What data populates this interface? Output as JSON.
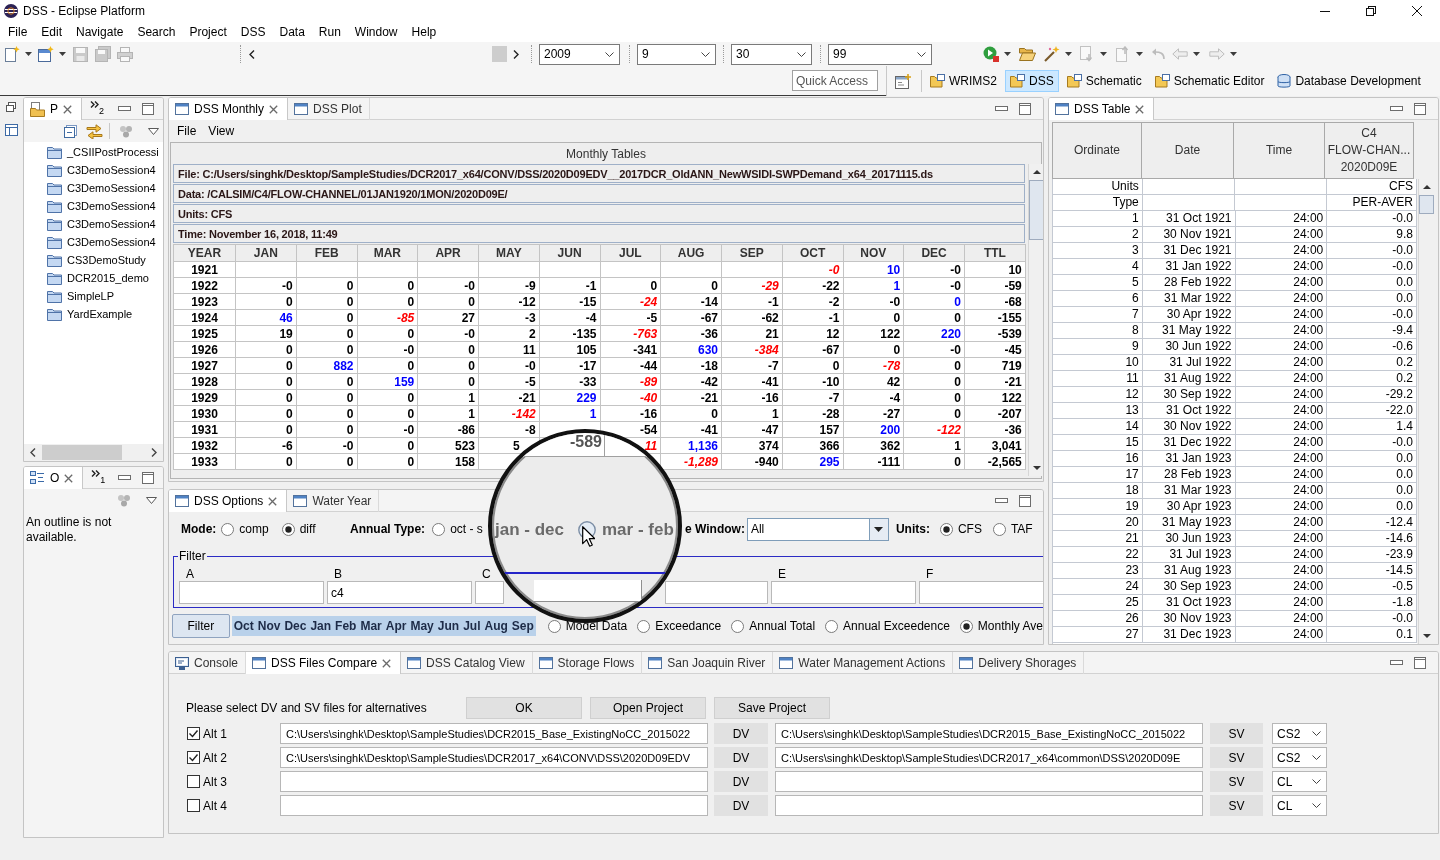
{
  "window": {
    "title": "DSS - Eclipse Platform"
  },
  "menu": [
    "File",
    "Edit",
    "Navigate",
    "Search",
    "Project",
    "DSS",
    "Data",
    "Run",
    "Window",
    "Help"
  ],
  "toolbar": {
    "left_tools": [
      {
        "kind": "new",
        "dropdown": true,
        "disabled": false
      },
      {
        "kind": "new-window",
        "dropdown": true,
        "disabled": false
      },
      {
        "kind": "save",
        "dropdown": false,
        "disabled": true
      },
      {
        "kind": "save-all",
        "dropdown": false,
        "disabled": true
      },
      {
        "kind": "print",
        "dropdown": false,
        "disabled": true
      }
    ],
    "combos": [
      {
        "value": "2009"
      },
      {
        "value": "9"
      },
      {
        "value": "30"
      },
      {
        "value": "99"
      }
    ],
    "right_tools": [
      {
        "kind": "run",
        "dropdown": true,
        "disabled": false
      },
      {
        "kind": "open",
        "dropdown": false,
        "disabled": false
      },
      {
        "kind": "wand",
        "dropdown": true,
        "disabled": false
      },
      {
        "kind": "next",
        "dropdown": true,
        "disabled": true
      },
      {
        "kind": "previous",
        "dropdown": true,
        "disabled": true
      },
      {
        "kind": "last-edit",
        "dropdown": false,
        "disabled": true
      },
      {
        "kind": "back",
        "dropdown": true,
        "disabled": true
      },
      {
        "kind": "forward",
        "dropdown": true,
        "disabled": true
      }
    ],
    "quick_access": {
      "placeholder": "Quick Access"
    },
    "perspectives": [
      {
        "label": "WRIMS2",
        "kind": "folder",
        "selected": false
      },
      {
        "label": "DSS",
        "kind": "folder",
        "selected": true
      },
      {
        "label": "Schematic",
        "kind": "folder",
        "selected": false
      },
      {
        "label": "Schematic Editor",
        "kind": "folder",
        "selected": false
      },
      {
        "label": "Database Development",
        "kind": "database",
        "selected": false
      }
    ]
  },
  "project_explorer": {
    "tab": {
      "label": "P",
      "selected": true
    },
    "overflow_count": "2",
    "items": [
      "_CSIIPostProcessi",
      "C3DemoSession4",
      "C3DemoSession4",
      "C3DemoSession4",
      "C3DemoSession4",
      "C3DemoSession4",
      "CS3DemoStudy",
      "DCR2015_demo",
      "SimpleLP",
      "YardExample"
    ]
  },
  "outline": {
    "tab": {
      "label": "O",
      "selected": true
    },
    "overflow_count": "1",
    "message": "An outline is not available."
  },
  "monthly_view": {
    "tabs": [
      {
        "label": "DSS Monthly",
        "selected": true
      },
      {
        "label": "DSS Plot",
        "selected": false
      }
    ],
    "menu": [
      "File",
      "View"
    ],
    "panel_title": "Monthly Tables",
    "info": [
      "File: C:/Users/singhk/Desktop/SampleStudies/DCR2017_x64/CONV/DSS/2020D09EDV__2017DCR_OldANN_NewWSIDI-SWPDemand_x64_20171115.ds",
      "Data: /CALSIM/C4/FLOW-CHANNEL/01JAN1920/1MON/2020D09E/",
      "Units: CFS",
      "Time: November 16, 2018, 11:49"
    ],
    "table": {
      "columns": [
        "YEAR",
        "JAN",
        "FEB",
        "MAR",
        "APR",
        "MAY",
        "JUN",
        "JUL",
        "AUG",
        "SEP",
        "OCT",
        "NOV",
        "DEC",
        "TTL"
      ],
      "rows": [
        [
          "1921",
          "",
          "",
          "",
          "",
          "",
          "",
          "",
          "",
          "",
          {
            "text": "-0",
            "color": "#ff0000"
          },
          {
            "text": "10",
            "color": "#0000ff"
          },
          "-0",
          "10"
        ],
        [
          "1922",
          "-0",
          "0",
          "0",
          "-0",
          "-9",
          "-1",
          "0",
          "0",
          {
            "text": "-29",
            "color": "#ff0000"
          },
          "-22",
          {
            "text": "1",
            "color": "#0000ff"
          },
          "-0",
          "-59"
        ],
        [
          "1923",
          "0",
          "0",
          "0",
          "0",
          "-12",
          "-15",
          {
            "text": "-24",
            "color": "#ff0000"
          },
          "-14",
          "-1",
          "-2",
          "-0",
          {
            "text": "0",
            "color": "#0000ff"
          },
          "-68"
        ],
        [
          "1924",
          {
            "text": "46",
            "color": "#0000ff"
          },
          "0",
          {
            "text": "-85",
            "color": "#ff0000"
          },
          "27",
          "-3",
          "-4",
          "-5",
          "-67",
          "-62",
          "-1",
          "0",
          "0",
          "-155"
        ],
        [
          "1925",
          "19",
          "0",
          "0",
          "-0",
          "2",
          "-135",
          {
            "text": "-763",
            "color": "#ff0000"
          },
          "-36",
          "21",
          "12",
          "122",
          {
            "text": "220",
            "color": "#0000ff"
          },
          "-539"
        ],
        [
          "1926",
          "0",
          "0",
          "-0",
          "0",
          "11",
          "105",
          "-341",
          {
            "text": "630",
            "color": "#0000ff"
          },
          {
            "text": "-384",
            "color": "#ff0000"
          },
          "-67",
          "0",
          "-0",
          "-45"
        ],
        [
          "1927",
          "0",
          {
            "text": "882",
            "color": "#0000ff"
          },
          "0",
          "0",
          "-0",
          "-17",
          "-44",
          "-18",
          "-7",
          "0",
          {
            "text": "-78",
            "color": "#ff0000"
          },
          "0",
          "719"
        ],
        [
          "1928",
          "0",
          "0",
          {
            "text": "159",
            "color": "#0000ff"
          },
          "0",
          "-5",
          "-33",
          {
            "text": "-89",
            "color": "#ff0000"
          },
          "-42",
          "-41",
          "-10",
          "42",
          "0",
          "-21"
        ],
        [
          "1929",
          "0",
          "0",
          "0",
          "1",
          "-21",
          {
            "text": "229",
            "color": "#0000ff"
          },
          {
            "text": "-40",
            "color": "#ff0000"
          },
          "-21",
          "-16",
          "-7",
          "-4",
          "0",
          "122"
        ],
        [
          "1930",
          "0",
          "0",
          "0",
          "1",
          {
            "text": "-142",
            "color": "#ff0000"
          },
          {
            "text": "1",
            "color": "#0000ff"
          },
          "-16",
          "0",
          "1",
          "-28",
          "-27",
          "0",
          "-207"
        ],
        [
          "1931",
          "0",
          "0",
          "-0",
          "-86",
          "-8",
          "",
          "-54",
          "-41",
          "-47",
          "157",
          {
            "text": "200",
            "color": "#0000ff"
          },
          {
            "text": "-122",
            "color": "#ff0000"
          },
          "-36"
        ],
        [
          "1932",
          "-6",
          "-0",
          "0",
          "523",
          "5",
          "",
          {
            "text": "11",
            "color": "#ff0000"
          },
          {
            "text": "1,136",
            "color": "#0000ff"
          },
          "374",
          "366",
          "362",
          "1",
          "3,041"
        ],
        [
          "1933",
          "0",
          "0",
          "0",
          "158",
          "",
          "",
          "",
          {
            "text": "-1,289",
            "color": "#ff0000"
          },
          "-940",
          {
            "text": "295",
            "color": "#0000ff"
          },
          "-111",
          "0",
          "-2,565"
        ]
      ]
    }
  },
  "options_view": {
    "tabs": [
      {
        "label": "DSS Options",
        "selected": true
      },
      {
        "label": "Water Year",
        "selected": false
      }
    ],
    "mode": {
      "label": "Mode:",
      "options": [
        {
          "label": "comp",
          "selected": false
        },
        {
          "label": "diff",
          "selected": true
        }
      ]
    },
    "annual_type": {
      "label": "Annual Type:",
      "options": [
        {
          "label": "oct - s",
          "selected": false
        }
      ]
    },
    "time_window": {
      "label": "e Window:",
      "value": "All"
    },
    "units": {
      "label": "Units:",
      "options": [
        {
          "label": "CFS",
          "selected": true
        },
        {
          "label": "TAF",
          "selected": false
        }
      ]
    },
    "filter": {
      "title": "Filter",
      "groups": [
        {
          "kind": "labeled",
          "label": "A"
        },
        {
          "kind": "labeled",
          "label": "B",
          "value": "c4"
        },
        {
          "kind": "labeled",
          "label": "C"
        },
        {
          "kind": "bare"
        },
        {
          "kind": "labeled",
          "label": "E"
        },
        {
          "kind": "labeled",
          "label": "F"
        }
      ]
    },
    "filter_button": "Filter",
    "months": [
      {
        "label": "Oct",
        "selected": true
      },
      {
        "label": "Nov",
        "selected": true
      },
      {
        "label": "Dec",
        "selected": true
      },
      {
        "label": "Jan",
        "selected": true
      },
      {
        "label": "Feb",
        "selected": true
      },
      {
        "label": "Mar",
        "selected": true
      },
      {
        "label": "Apr",
        "selected": true
      },
      {
        "label": "May",
        "selected": true
      },
      {
        "label": "Jun",
        "selected": true
      },
      {
        "label": "Jul",
        "selected": true
      },
      {
        "label": "Aug",
        "selected": true
      },
      {
        "label": "Sep",
        "selected": true
      }
    ],
    "views": [
      {
        "label": "Model Data",
        "selected": false
      },
      {
        "label": "Exceedance",
        "selected": false
      },
      {
        "label": "Annual Total",
        "selected": false
      },
      {
        "label": "Annual Exceedence",
        "selected": false
      },
      {
        "label": "Monthly Ave",
        "selected": true
      }
    ]
  },
  "magnifier": {
    "cell": "-589",
    "items": [
      {
        "kind": "text",
        "label": "jan - dec"
      },
      {
        "kind": "radio",
        "label": "mar - feb",
        "selected": false
      }
    ]
  },
  "table_view": {
    "tab": {
      "label": "DSS Table",
      "selected": true
    },
    "columns": [
      {
        "lines": [
          "Ordinate"
        ]
      },
      {
        "lines": [
          "Date"
        ]
      },
      {
        "lines": [
          "Time"
        ]
      },
      {
        "lines": [
          "C4",
          "FLOW-CHAN...",
          "2020D09E"
        ]
      }
    ],
    "meta_rows": [
      {
        "label": "Units",
        "value": "CFS"
      },
      {
        "label": "Type",
        "value": "PER-AVER"
      }
    ],
    "rows": [
      [
        "1",
        "31 Oct 1921",
        "24:00",
        "-0.0"
      ],
      [
        "2",
        "30 Nov 1921",
        "24:00",
        "9.8"
      ],
      [
        "3",
        "31 Dec 1921",
        "24:00",
        "-0.0"
      ],
      [
        "4",
        "31 Jan 1922",
        "24:00",
        "-0.0"
      ],
      [
        "5",
        "28 Feb 1922",
        "24:00",
        "0.0"
      ],
      [
        "6",
        "31 Mar 1922",
        "24:00",
        "0.0"
      ],
      [
        "7",
        "30 Apr 1922",
        "24:00",
        "-0.0"
      ],
      [
        "8",
        "31 May 1922",
        "24:00",
        "-9.4"
      ],
      [
        "9",
        "30 Jun 1922",
        "24:00",
        "-0.6"
      ],
      [
        "10",
        "31 Jul 1922",
        "24:00",
        "0.2"
      ],
      [
        "11",
        "31 Aug 1922",
        "24:00",
        "0.2"
      ],
      [
        "12",
        "30 Sep 1922",
        "24:00",
        "-29.2"
      ],
      [
        "13",
        "31 Oct 1922",
        "24:00",
        "-22.0"
      ],
      [
        "14",
        "30 Nov 1922",
        "24:00",
        "1.4"
      ],
      [
        "15",
        "31 Dec 1922",
        "24:00",
        "-0.0"
      ],
      [
        "16",
        "31 Jan 1923",
        "24:00",
        "0.0"
      ],
      [
        "17",
        "28 Feb 1923",
        "24:00",
        "0.0"
      ],
      [
        "18",
        "31 Mar 1923",
        "24:00",
        "0.0"
      ],
      [
        "19",
        "30 Apr 1923",
        "24:00",
        "0.0"
      ],
      [
        "20",
        "31 May 1923",
        "24:00",
        "-12.4"
      ],
      [
        "21",
        "30 Jun 1923",
        "24:00",
        "-14.6"
      ],
      [
        "22",
        "31 Jul 1923",
        "24:00",
        "-23.9"
      ],
      [
        "23",
        "31 Aug 1923",
        "24:00",
        "-14.5"
      ],
      [
        "24",
        "30 Sep 1923",
        "24:00",
        "-0.5"
      ],
      [
        "25",
        "31 Oct 1923",
        "24:00",
        "-1.8"
      ],
      [
        "26",
        "30 Nov 1923",
        "24:00",
        "-0.0"
      ],
      [
        "27",
        "31 Dec 1923",
        "24:00",
        "0.1"
      ]
    ]
  },
  "compare_view": {
    "tabs": [
      {
        "label": "Console",
        "kind": "console",
        "selected": false
      },
      {
        "label": "DSS Files Compare",
        "kind": "view",
        "selected": true
      },
      {
        "label": "DSS Catalog View",
        "kind": "view",
        "selected": false
      },
      {
        "label": "Storage Flows",
        "kind": "view",
        "selected": false
      },
      {
        "label": "San Joaquin River",
        "kind": "view",
        "selected": false
      },
      {
        "label": "Water Management Actions",
        "kind": "view",
        "selected": false
      },
      {
        "label": "Delivery Shorages",
        "kind": "view",
        "selected": false
      }
    ],
    "prompt": "Please select DV and SV files for alternatives",
    "buttons": [
      "OK",
      "Open Project",
      "Save Project"
    ],
    "alternatives": [
      {
        "label": "Alt 1",
        "checked": true,
        "dv_path": "C:\\Users\\singhk\\Desktop\\SampleStudies\\DCR2015_Base_ExistingNoCC_2015022",
        "dv_button": "DV",
        "sv_path": "C:\\Users\\singhk\\Desktop\\SampleStudies\\DCR2015_Base_ExistingNoCC_2015022",
        "sv_button": "SV",
        "type": "CS2"
      },
      {
        "label": "Alt 2",
        "checked": true,
        "dv_path": "C:\\Users\\singhk\\Desktop\\SampleStudies\\DCR2017_x64\\CONV\\DSS\\2020D09EDV",
        "dv_button": "DV",
        "sv_path": "C:\\Users\\singhk\\Desktop\\SampleStudies\\DCR2017_x64\\common\\DSS\\2020D09E",
        "sv_button": "SV",
        "type": "CS2"
      },
      {
        "label": "Alt 3",
        "checked": false,
        "dv_button": "DV",
        "sv_button": "SV",
        "type": "CL"
      },
      {
        "label": "Alt 4",
        "checked": false,
        "dv_button": "DV",
        "sv_button": "SV",
        "type": "CL"
      }
    ]
  }
}
